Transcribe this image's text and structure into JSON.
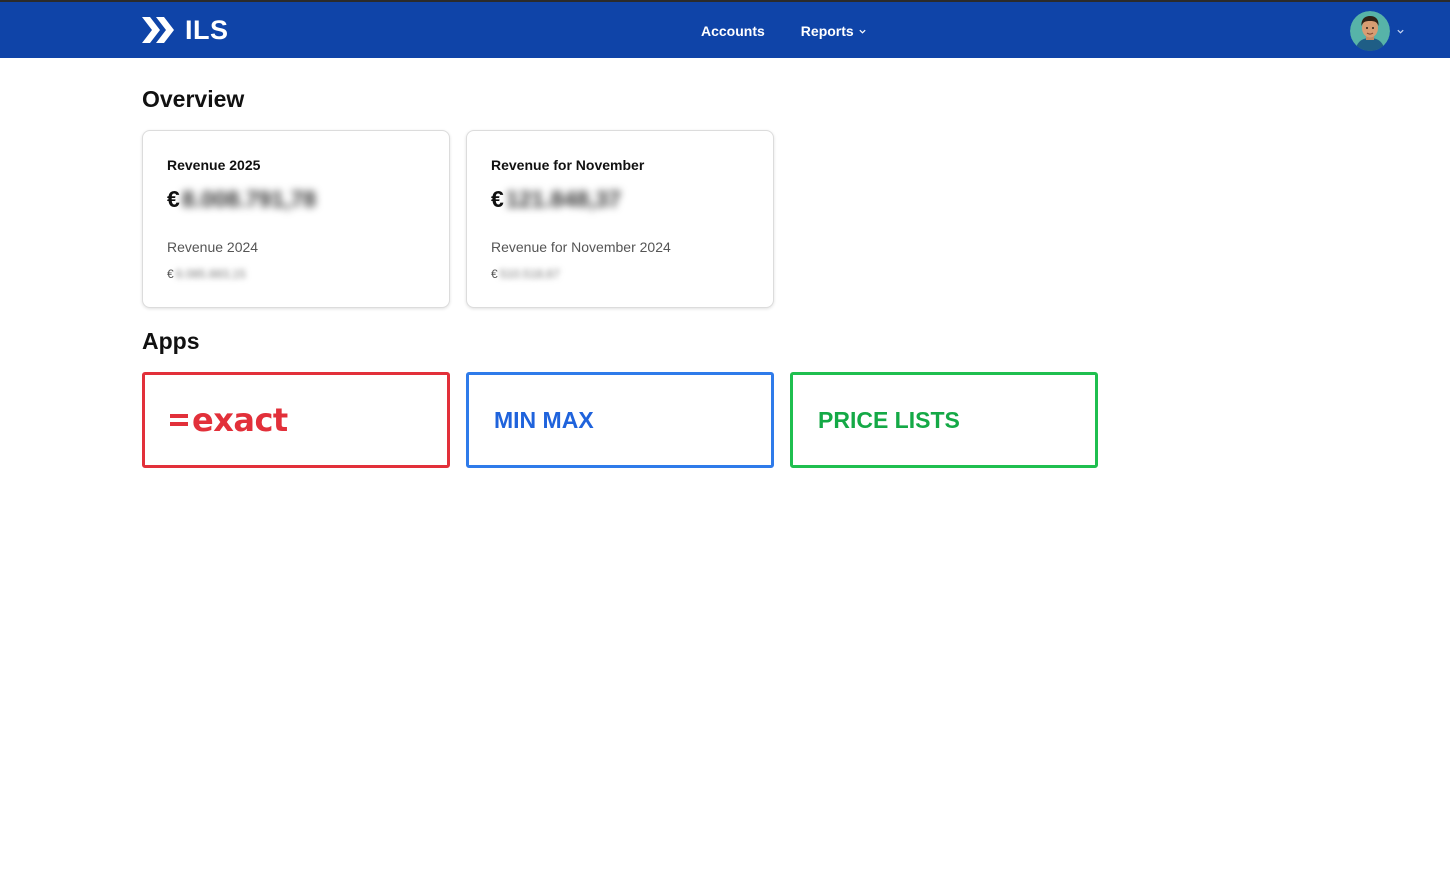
{
  "navbar": {
    "brand_name": "ILS",
    "brand_icon": "double-chevron-logo-icon",
    "links": [
      {
        "label": "Accounts",
        "has_dropdown": false
      },
      {
        "label": "Reports",
        "has_dropdown": true
      }
    ],
    "user_avatar_icon": "user-avatar-icon",
    "background_color": "#0f44a8"
  },
  "overview": {
    "title": "Overview",
    "cards": [
      {
        "label": "Revenue 2025",
        "currency": "€",
        "value": "8.008.791,78",
        "compare_label": "Revenue 2024",
        "compare_currency": "€",
        "compare_value": "6.085.883,15"
      },
      {
        "label": "Revenue for November",
        "currency": "€",
        "value": "121.848,37",
        "compare_label": "Revenue for November 2024",
        "compare_currency": "€",
        "compare_value": "510.518,67"
      }
    ]
  },
  "apps": {
    "title": "Apps",
    "tiles": [
      {
        "label": "exact",
        "logo_prefix": "=",
        "color": "#e2303a"
      },
      {
        "label": "MIN MAX",
        "color": "#2f7bea"
      },
      {
        "label": "PRICE LISTS",
        "color": "#1fbf4f"
      }
    ]
  }
}
